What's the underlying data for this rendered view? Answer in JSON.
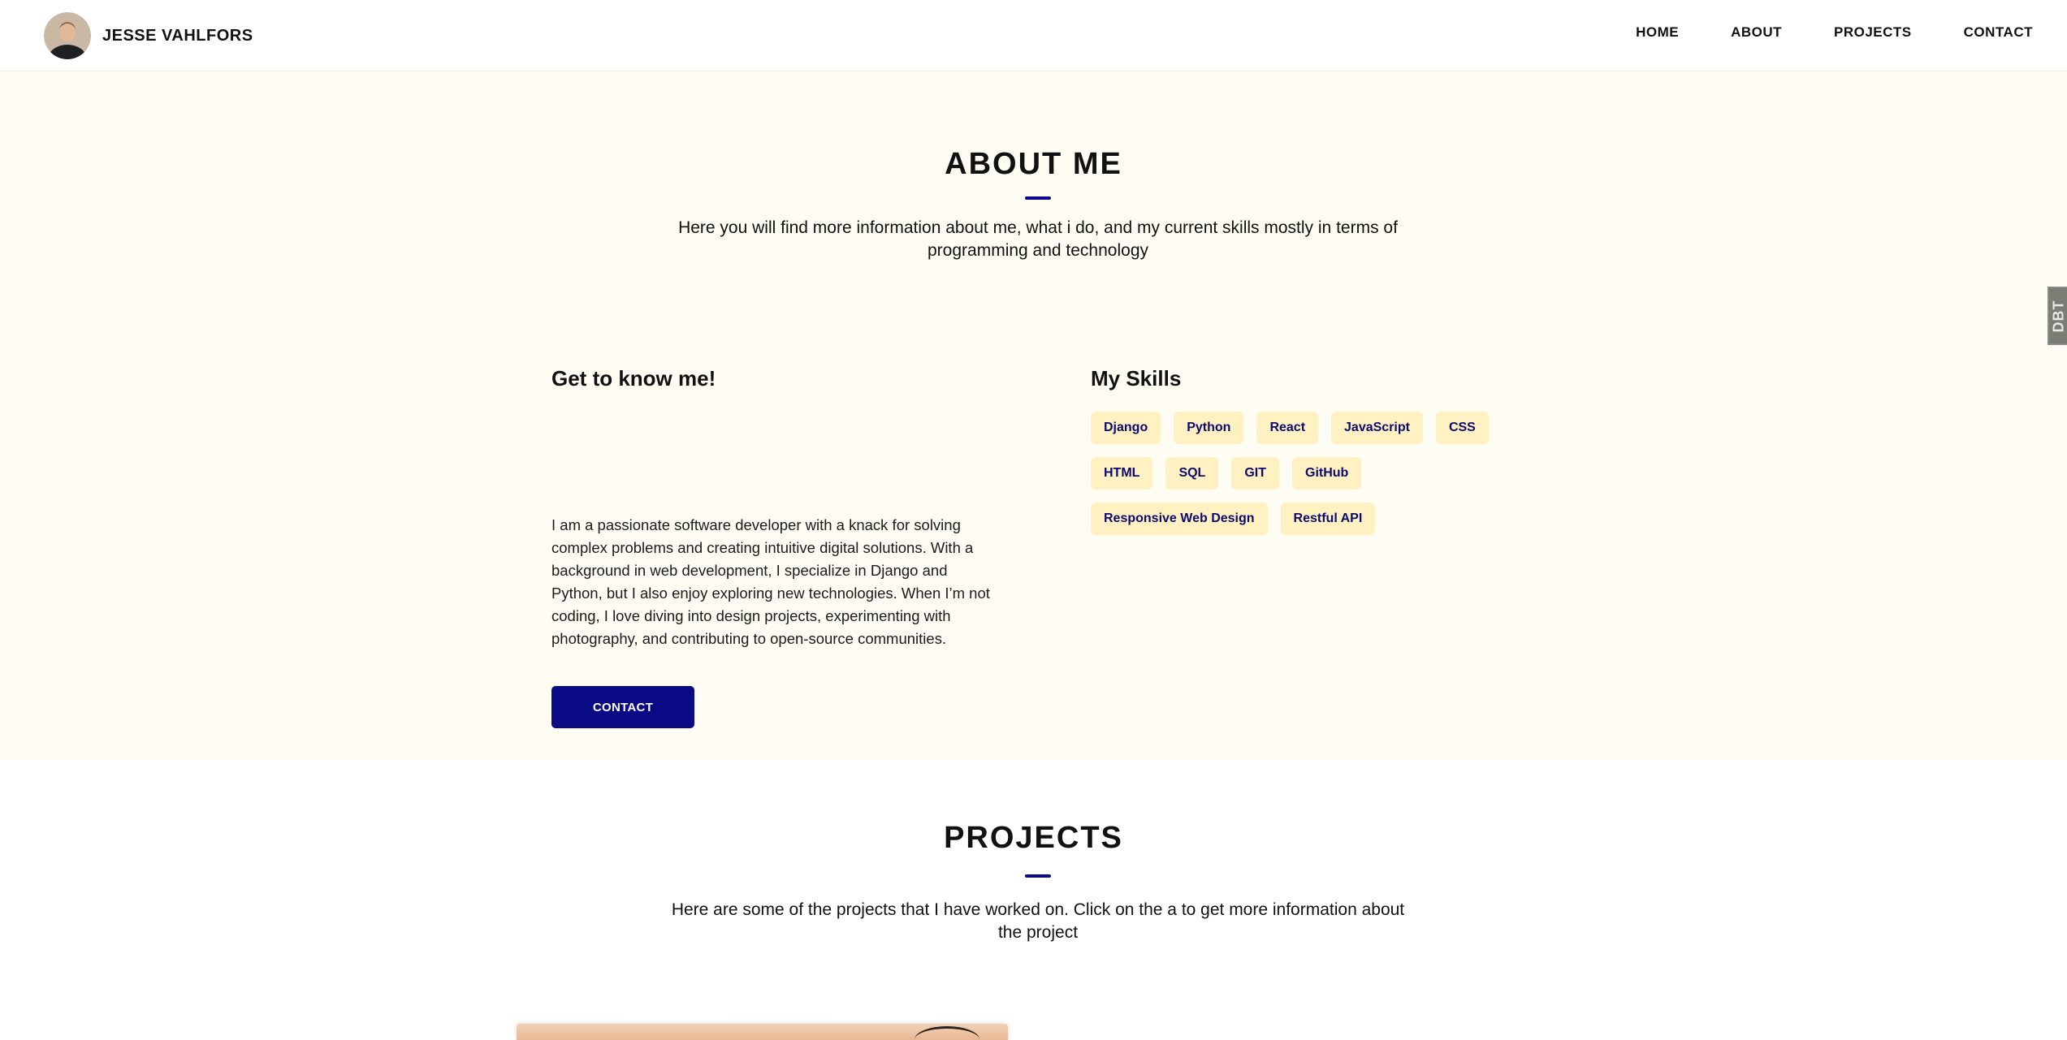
{
  "header": {
    "brand_name": "JESSE VAHLFORS",
    "nav": [
      {
        "label": "HOME"
      },
      {
        "label": "ABOUT"
      },
      {
        "label": "PROJECTS"
      },
      {
        "label": "CONTACT"
      }
    ]
  },
  "about": {
    "title": "ABOUT ME",
    "lead": "Here you will find more information about me, what i do, and my current skills mostly in terms of programming and technology",
    "intro_heading": "Get to know me!",
    "intro_text": "I am a passionate software developer with a knack for solving complex problems and creating intuitive digital solutions. With a background in web development, I specialize in Django and Python, but I also enjoy exploring new technologies. When I’m not coding, I love diving into design projects, experimenting with photography, and contributing to open-source communities.",
    "contact_button": "CONTACT",
    "skills_heading": "My Skills",
    "skills": [
      "Django",
      "Python",
      "React",
      "JavaScript",
      "CSS",
      "HTML",
      "SQL",
      "GIT",
      "GitHub",
      "Responsive Web Design",
      "Restful API"
    ]
  },
  "projects": {
    "title": "PROJECTS",
    "lead": "Here are some of the projects that I have worked on. Click on the a to get more information about the project"
  },
  "side_tab": {
    "label": "DBT"
  },
  "colors": {
    "accent": "#0b0a85",
    "about_bg": "#fffcf3",
    "skill_bg": "#fff1c2",
    "skill_text": "#0b0a6e"
  },
  "icons": {
    "avatar": "profile-photo"
  }
}
